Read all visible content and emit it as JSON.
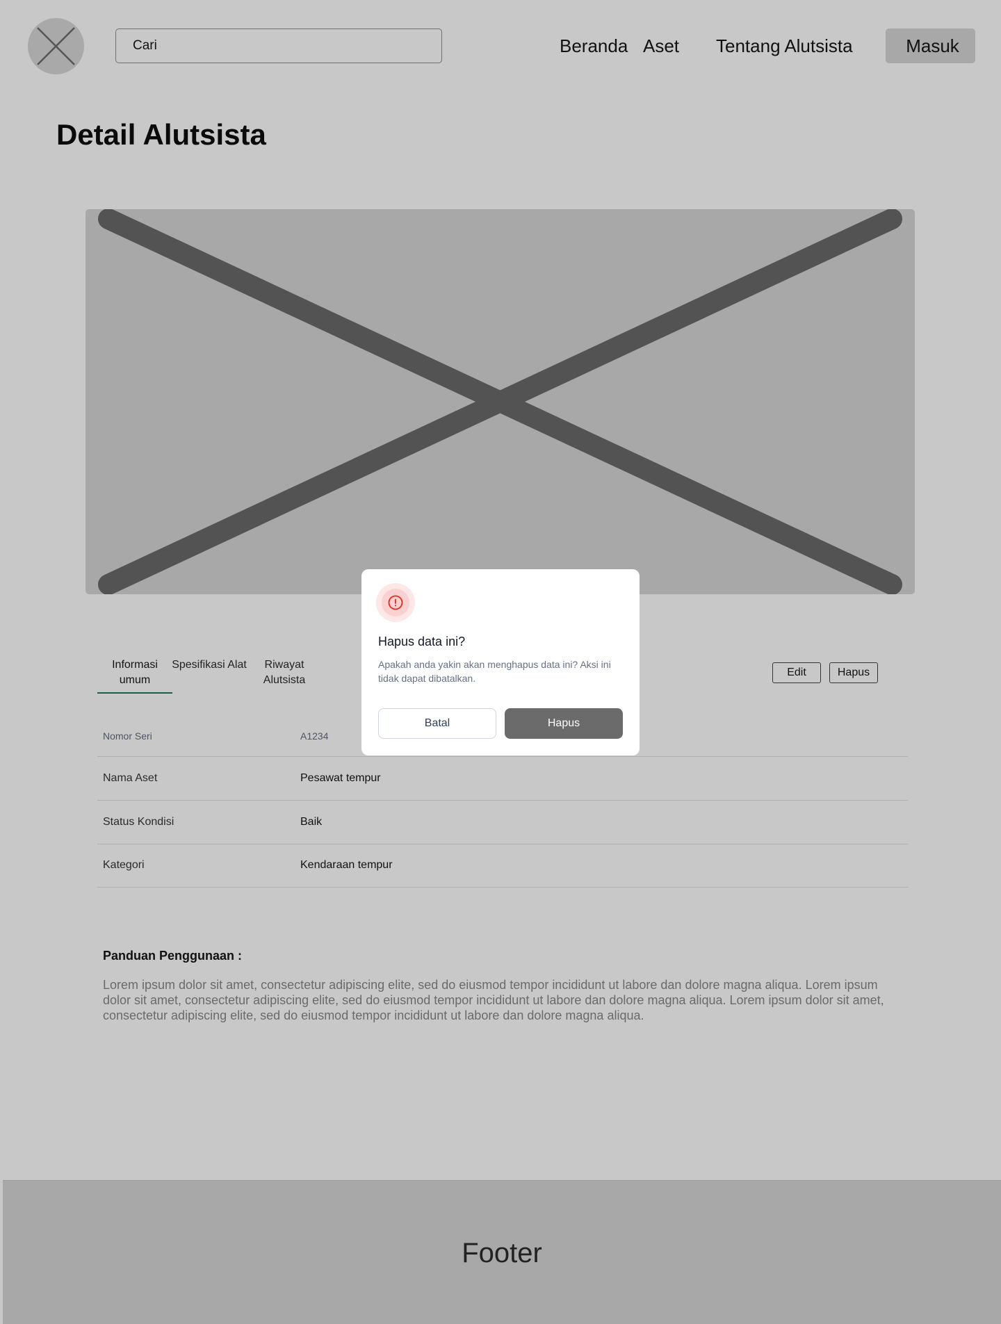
{
  "header": {
    "logo_icon": "placeholder-x-icon",
    "search_placeholder": "Cari",
    "nav": [
      {
        "label": "Beranda"
      },
      {
        "label": "Aset"
      },
      {
        "label": "Tentang Alutsista"
      }
    ],
    "login_label": "Masuk"
  },
  "page": {
    "title": "Detail Alutsista",
    "hero_image_icon": "image-placeholder-icon"
  },
  "tabs": [
    {
      "label": "Informasi umum",
      "active": true
    },
    {
      "label": "Spesifikasi Alat",
      "active": false
    },
    {
      "label": "Riwayat Alutsista",
      "active": false
    }
  ],
  "actions": {
    "edit_label": "Edit",
    "delete_label": "Hapus"
  },
  "info_rows": [
    {
      "label": "Nomor Seri",
      "value": "A1234"
    },
    {
      "label": "Nama Aset",
      "value": "Pesawat tempur"
    },
    {
      "label": "Status Kondisi",
      "value": "Baik"
    },
    {
      "label": "Kategori",
      "value": "Kendaraan tempur"
    }
  ],
  "guide": {
    "title": "Panduan Penggunaan :",
    "text": "Lorem ipsum dolor sit amet, consectetur adipiscing elite, sed do eiusmod tempor incididunt ut labore dan dolore magna aliqua. Lorem ipsum dolor sit amet, consectetur adipiscing elite, sed do eiusmod tempor incididunt ut labore dan dolore magna aliqua. Lorem ipsum dolor sit amet, consectetur adipiscing elite, sed do eiusmod tempor incididunt ut labore dan dolore magna aliqua."
  },
  "footer": {
    "label": "Footer"
  },
  "modal": {
    "icon": "alert-circle-icon",
    "title": "Hapus data ini?",
    "description": "Apakah anda yakin akan menghapus data ini? Aksi ini tidak dapat dibatalkan.",
    "cancel_label": "Batal",
    "confirm_label": "Hapus",
    "accent_color": "#d92d20"
  }
}
